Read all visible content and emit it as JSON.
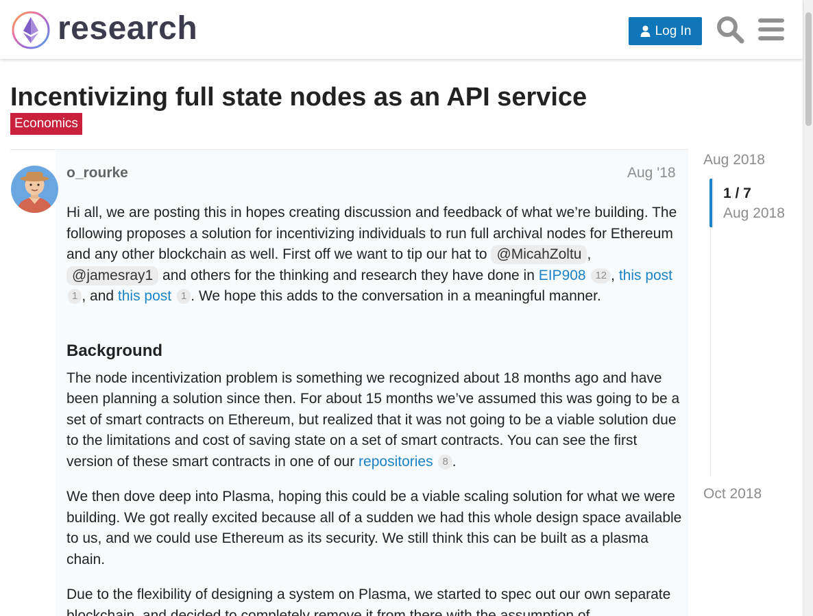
{
  "header": {
    "logo_icon": "ethereum-research-logo-icon",
    "logo_text": "research",
    "login_label": "Log In",
    "search_icon": "search-icon",
    "menu_icon": "hamburger-menu-icon",
    "accent_color": "#0f76b9"
  },
  "topic": {
    "title": "Incentivizing full state nodes as an API service",
    "category": "Economics",
    "category_color": "#c8203d"
  },
  "post": {
    "username": "o_rourke",
    "date": "Aug '18",
    "intro": {
      "t1": "Hi all, we are posting this in hopes creating discussion and feedback of what we’re building. The following proposes a solution for incentivizing individuals to run full archival nodes for Ethereum and any other blockchain as well. First off we want to tip our hat to ",
      "mention1": "@MicahZoltu",
      "t2": ", ",
      "mention2": "@jamesray1",
      "t3": " and others for the thinking and research they have done in ",
      "link1": "EIP908",
      "link1_count": "12",
      "t4": ", ",
      "link2": "this post",
      "link2_count": "1",
      "t5": ", and ",
      "link3": "this post",
      "link3_count": "1",
      "t6": ". We hope this adds to the conversation in a meaningful manner."
    },
    "heading_background": "Background",
    "para2": {
      "t1": "The node incentivization problem is something we recognized about 18 months ago and have been planning a solution since then. For about 15 months we’ve assumed this was going to be a set of smart contracts on Ethereum, but realized that it was not going to be a viable solution due to the limitations and cost of saving state on a set of smart contracts. You can see the first version of these smart contracts in one of our ",
      "link": "repositories",
      "link_count": "8",
      "t2": "."
    },
    "para3": "We then dove deep into Plasma, hoping this could be a viable scaling solution for what we were building. We got really excited because all of a sudden we had this whole design space available to us, and we could use Ethereum as its security. We still think this can be built as a plasma chain.",
    "para4": "Due to the flexibility of designing a system on Plasma, we started to spec out our own separate blockchain, and decided to completely remove it from there with the assumption of"
  },
  "timeline": {
    "start_date": "Aug 2018",
    "position": "1 / 7",
    "position_date": "Aug 2018",
    "end_date": "Oct 2018"
  }
}
